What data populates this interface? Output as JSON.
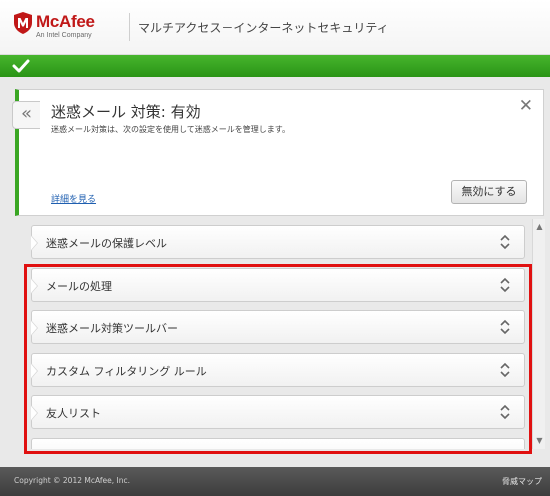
{
  "header": {
    "brand": "McAfee",
    "brand_sub": "An Intel Company",
    "app_title": "マルチアクセス－インターネットセキュリティ",
    "brand_color": "#c01818"
  },
  "status": {
    "color": "#3aa623",
    "icon": "check-icon"
  },
  "panel": {
    "back_icon": "«",
    "title": "迷惑メール 対策: 有効",
    "description": "迷惑メール対策は、次の設定を使用して迷惑メールを管理します。",
    "close_icon": "✕",
    "details_link": "詳細を見る",
    "disable_button": "無効にする"
  },
  "settings": {
    "items": [
      {
        "label": "迷惑メールの保護レベル"
      },
      {
        "label": "メールの処理"
      },
      {
        "label": "迷惑メール対策ツールバー"
      },
      {
        "label": "カスタム フィルタリング ルール"
      },
      {
        "label": "友人リスト"
      },
      {
        "label": ""
      }
    ]
  },
  "scrollbar": {
    "up_icon": "▲",
    "down_icon": "▼"
  },
  "highlight": {
    "color": "#e01010"
  },
  "footer": {
    "copyright": "Copyright © 2012 McAfee, Inc.",
    "threat_map": "脅威マップ"
  }
}
